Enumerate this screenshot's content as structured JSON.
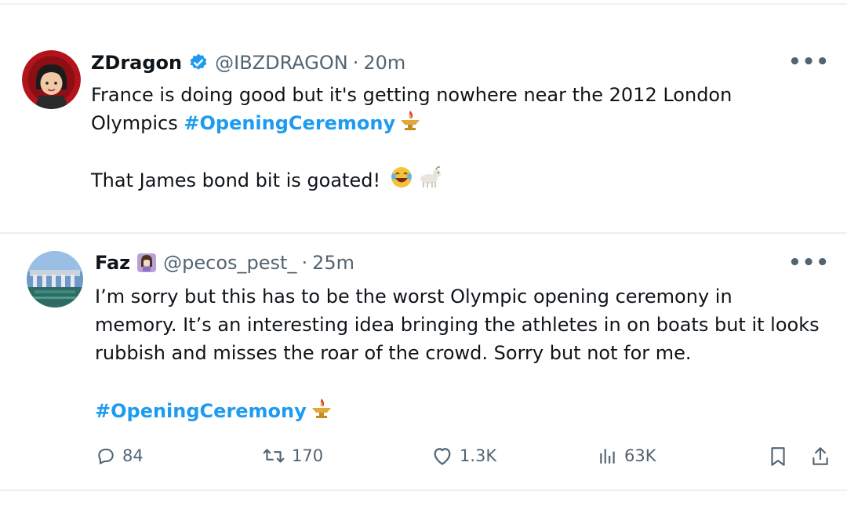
{
  "tweets": [
    {
      "display_name": "ZDragon",
      "handle": "@IBZDRAGON",
      "separator": "·",
      "time": "20m",
      "lines": [
        "France is doing good but it's getting  nowhere near the 2012 London",
        "Olympics ",
        "That James bond bit is goated! "
      ],
      "hashtag": "#OpeningCeremony",
      "more": "•••"
    },
    {
      "display_name": "Faz",
      "handle": "@pecos_pest_",
      "separator": "·",
      "time": "25m",
      "lines": [
        "I’m sorry but this has to be the worst Olympic opening ceremony in",
        "memory. It’s an interesting idea bringing the athletes in on boats but it looks",
        "rubbish and misses the roar of the crowd. Sorry but not for me."
      ],
      "hashtag": "#OpeningCeremony",
      "more": "•••",
      "actions": {
        "replies": "84",
        "reposts": "170",
        "likes": "1.3K",
        "views": "63K"
      }
    }
  ],
  "colors": {
    "link": "#1d9bf0",
    "muted": "#536471",
    "text": "#0f1419",
    "verified": "#1d9bf0"
  },
  "icons": {
    "verified": "verified-badge-icon",
    "torch": "olympic-torch-icon",
    "laughing": "laughing-emoji-icon",
    "goat": "goat-emoji-icon",
    "reply": "reply-icon",
    "repost": "repost-icon",
    "like": "heart-icon",
    "views": "views-icon",
    "bookmark": "bookmark-icon",
    "share": "share-icon",
    "more": "more-icon"
  }
}
